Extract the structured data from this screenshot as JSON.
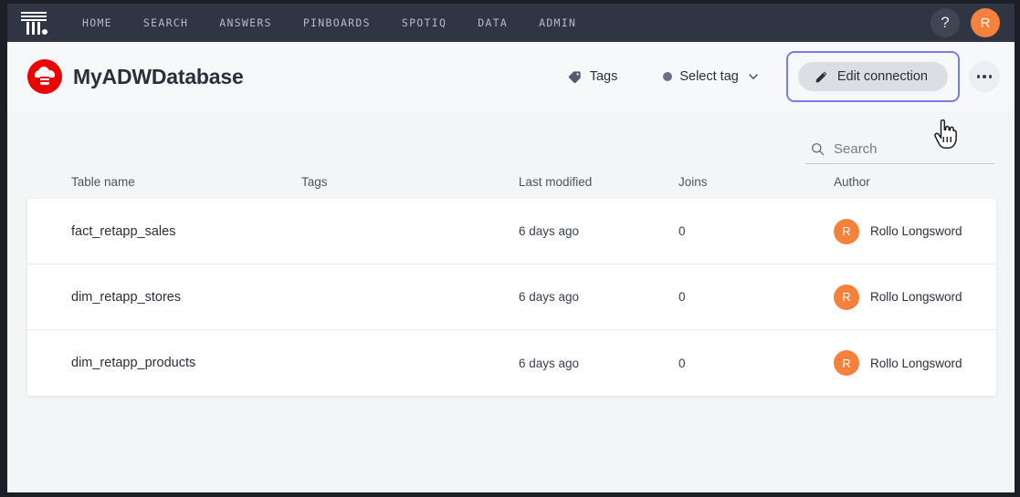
{
  "topnav": {
    "logo_name": "thoughtspot-logo",
    "links": [
      {
        "label": "HOME"
      },
      {
        "label": "SEARCH"
      },
      {
        "label": "ANSWERS"
      },
      {
        "label": "PINBOARDS"
      },
      {
        "label": "SPOTIQ"
      },
      {
        "label": "DATA"
      },
      {
        "label": "ADMIN"
      }
    ],
    "help_label": "?",
    "avatar_initial": "R",
    "bg_color": "#2f3542",
    "link_color": "#b4bac6",
    "avatar_color": "#f5813d"
  },
  "header": {
    "db_title": "MyADWDatabase",
    "db_logo_color": "#eb0000",
    "tags_label": "Tags",
    "select_tag_label": "Select tag",
    "edit_connection_label": "Edit connection",
    "focus_ring_color": "#7b7ce8",
    "more_label": "More options"
  },
  "search": {
    "placeholder": "Search",
    "value": ""
  },
  "table": {
    "columns": [
      {
        "key": "name",
        "label": "Table name"
      },
      {
        "key": "tags",
        "label": "Tags"
      },
      {
        "key": "modified",
        "label": "Last modified"
      },
      {
        "key": "joins",
        "label": "Joins"
      },
      {
        "key": "author",
        "label": "Author"
      }
    ],
    "rows": [
      {
        "name": "fact_retapp_sales",
        "tags": "",
        "modified": "6 days ago",
        "joins": "0",
        "author": "Rollo Longsword",
        "author_initial": "R"
      },
      {
        "name": "dim_retapp_stores",
        "tags": "",
        "modified": "6 days ago",
        "joins": "0",
        "author": "Rollo Longsword",
        "author_initial": "R"
      },
      {
        "name": "dim_retapp_products",
        "tags": "",
        "modified": "6 days ago",
        "joins": "0",
        "author": "Rollo Longsword",
        "author_initial": "R"
      }
    ]
  }
}
